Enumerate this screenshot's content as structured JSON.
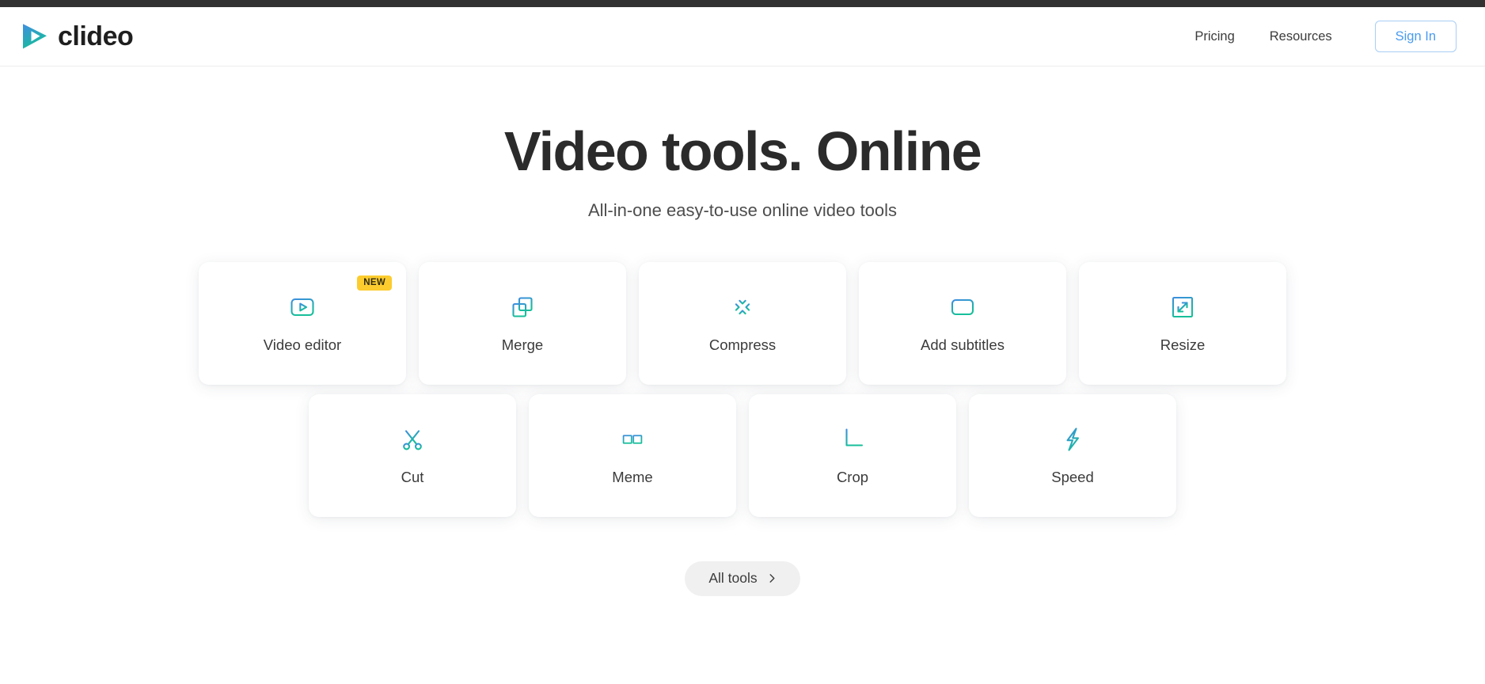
{
  "brand": {
    "name": "clideo",
    "logo_icon": "play-triangle-logo-icon"
  },
  "header": {
    "nav_links": [
      {
        "label": "Pricing",
        "name": "nav-link-pricing"
      },
      {
        "label": "Resources",
        "name": "nav-link-resources"
      }
    ],
    "signin_label": "Sign In"
  },
  "hero": {
    "title": "Video tools. Online",
    "subtitle": "All-in-one easy-to-use online video tools"
  },
  "tools": {
    "row1": [
      {
        "label": "Video editor",
        "icon": "video-player-play-icon",
        "badge": "NEW"
      },
      {
        "label": "Merge",
        "icon": "overlapping-squares-icon",
        "badge": ""
      },
      {
        "label": "Compress",
        "icon": "arrows-inward-icon",
        "badge": ""
      },
      {
        "label": "Add subtitles",
        "icon": "subtitle-box-icon",
        "badge": ""
      },
      {
        "label": "Resize",
        "icon": "diagonal-resize-arrows-icon",
        "badge": ""
      }
    ],
    "row2": [
      {
        "label": "Cut",
        "icon": "scissors-icon",
        "badge": ""
      },
      {
        "label": "Meme",
        "icon": "glasses-icon",
        "badge": ""
      },
      {
        "label": "Crop",
        "icon": "crop-marks-icon",
        "badge": ""
      },
      {
        "label": "Speed",
        "icon": "lightning-bolt-icon",
        "badge": ""
      }
    ]
  },
  "footer_action": {
    "all_tools_label": "All tools",
    "chevron_icon": "chevron-right-icon"
  },
  "colors": {
    "top_strip": "#323232",
    "accent_blue": "#3d8ede",
    "accent_teal": "#17bf9a",
    "badge_yellow": "#fccc2f",
    "signin_blue": "#4a9bf0",
    "text_dark": "#2b2b2b"
  }
}
